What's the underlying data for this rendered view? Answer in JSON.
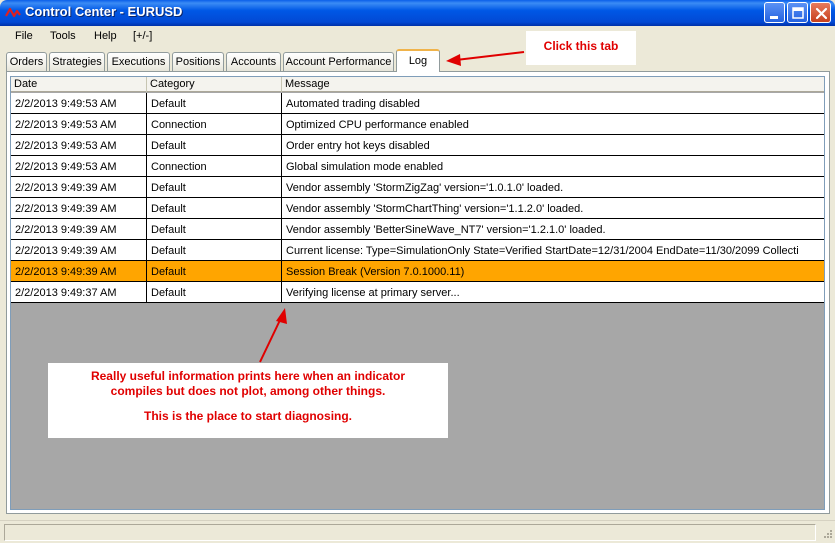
{
  "window": {
    "title": "Control Center - EURUSD",
    "title_bar_color": "#0058e6"
  },
  "menu": {
    "items": [
      "File",
      "Tools",
      "Help",
      "[+/-]"
    ]
  },
  "tabs": [
    {
      "label": "Orders",
      "active": false
    },
    {
      "label": "Strategies",
      "active": false
    },
    {
      "label": "Executions",
      "active": false
    },
    {
      "label": "Positions",
      "active": false
    },
    {
      "label": "Accounts",
      "active": false
    },
    {
      "label": "Account Performance",
      "active": false
    },
    {
      "label": "Log",
      "active": true
    }
  ],
  "log": {
    "columns": [
      "Date",
      "Category",
      "Message"
    ],
    "highlight_color": "#ffa500",
    "rows": [
      {
        "date": "2/2/2013 9:49:53 AM",
        "category": "Default",
        "message": "Automated trading disabled",
        "highlight": false
      },
      {
        "date": "2/2/2013 9:49:53 AM",
        "category": "Connection",
        "message": "Optimized CPU performance enabled",
        "highlight": false
      },
      {
        "date": "2/2/2013 9:49:53 AM",
        "category": "Default",
        "message": "Order entry hot keys disabled",
        "highlight": false
      },
      {
        "date": "2/2/2013 9:49:53 AM",
        "category": "Connection",
        "message": "Global simulation mode enabled",
        "highlight": false
      },
      {
        "date": "2/2/2013 9:49:39 AM",
        "category": "Default",
        "message": "Vendor assembly  'StormZigZag'  version='1.0.1.0'  loaded.",
        "highlight": false
      },
      {
        "date": "2/2/2013 9:49:39 AM",
        "category": "Default",
        "message": "Vendor assembly  'StormChartThing'  version='1.1.2.0'  loaded.",
        "highlight": false
      },
      {
        "date": "2/2/2013 9:49:39 AM",
        "category": "Default",
        "message": "Vendor assembly  'BetterSineWave_NT7'  version='1.2.1.0'  loaded.",
        "highlight": false
      },
      {
        "date": "2/2/2013 9:49:39 AM",
        "category": "Default",
        "message": "Current license:  Type=SimulationOnly  State=Verified  StartDate=12/31/2004  EndDate=11/30/2099  Collecti",
        "highlight": false
      },
      {
        "date": "2/2/2013 9:49:39 AM",
        "category": "Default",
        "message": "Session Break (Version 7.0.1000.11)",
        "highlight": true
      },
      {
        "date": "2/2/2013 9:49:37 AM",
        "category": "Default",
        "message": "Verifying license at primary server...",
        "highlight": false
      }
    ]
  },
  "annotations": {
    "tab_callout": "Click this tab",
    "info_line1": "Really useful information prints here when an indicator",
    "info_line2": "compiles but does not plot, among other things.",
    "info_line3": "This is the place to start diagnosing.",
    "color": "#e00000"
  },
  "icons": {
    "app": "trend-logo-icon",
    "minimize": "minimize-icon",
    "maximize": "maximize-icon",
    "close": "close-icon",
    "grip": "resize-grip-icon"
  }
}
